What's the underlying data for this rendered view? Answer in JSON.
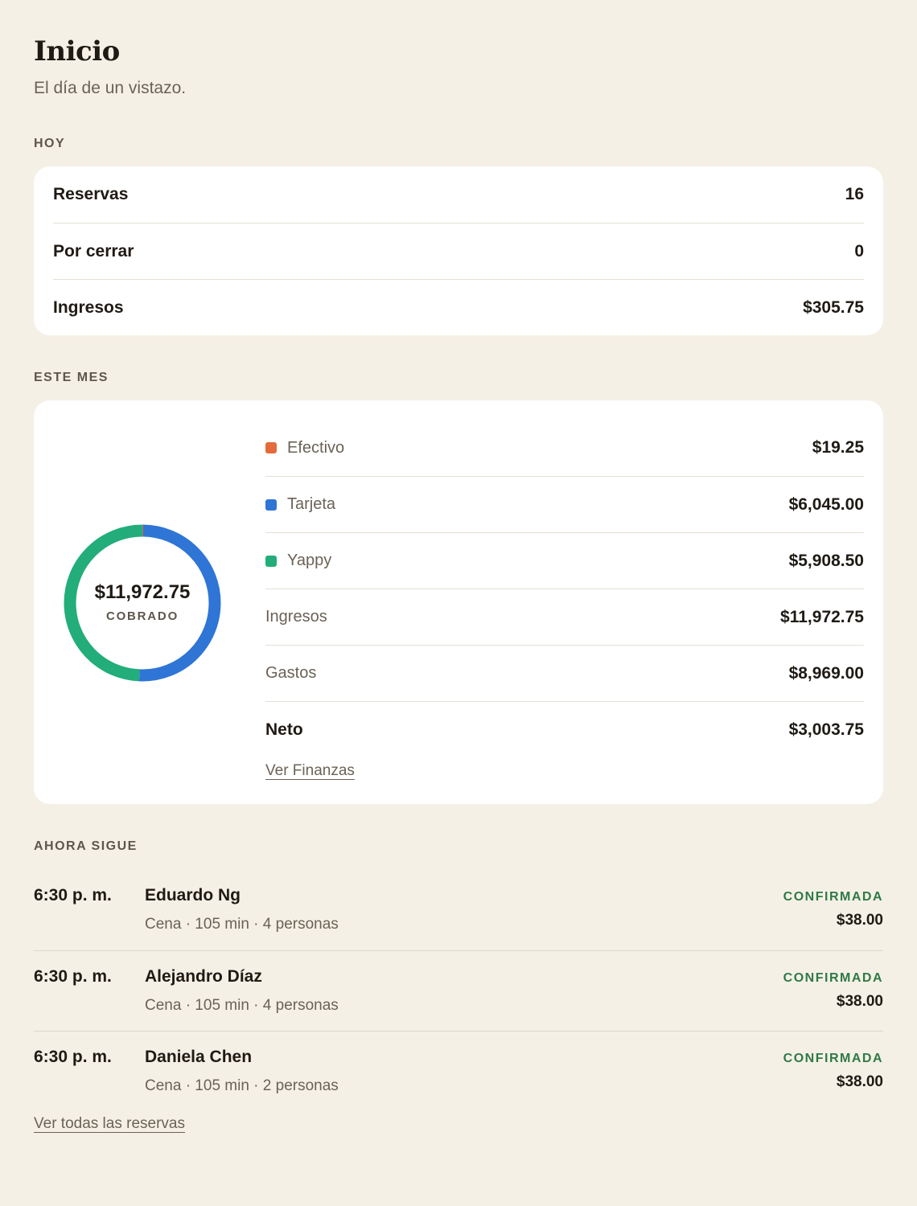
{
  "header": {
    "title": "Inicio",
    "subtitle": "El día de un vistazo."
  },
  "today": {
    "section_label": "HOY",
    "rows": [
      {
        "label": "Reservas",
        "value": "16"
      },
      {
        "label": "Por cerrar",
        "value": "0"
      },
      {
        "label": "Ingresos",
        "value": "$305.75"
      }
    ]
  },
  "month": {
    "section_label": "ESTE MES",
    "donut_total": "$11,972.75",
    "donut_caption": "COBRADO",
    "methods": [
      {
        "label": "Efectivo",
        "value": "$19.25",
        "color": "#e46a3c"
      },
      {
        "label": "Tarjeta",
        "value": "$6,045.00",
        "color": "#2f75d6"
      },
      {
        "label": "Yappy",
        "value": "$5,908.50",
        "color": "#22ad7a"
      }
    ],
    "totals": [
      {
        "label": "Ingresos",
        "value": "$11,972.75"
      },
      {
        "label": "Gastos",
        "value": "$8,969.00"
      },
      {
        "label": "Neto",
        "value": "$3,003.75"
      }
    ],
    "link": "Ver Finanzas"
  },
  "chart_data": {
    "type": "pie",
    "categories": [
      "Efectivo",
      "Tarjeta",
      "Yappy"
    ],
    "values": [
      19.25,
      6045.0,
      5908.5
    ],
    "colors": [
      "#e46a3c",
      "#2f75d6",
      "#22ad7a"
    ],
    "title": "",
    "center_label": "$11,972.75",
    "center_caption": "COBRADO"
  },
  "upcoming": {
    "section_label": "AHORA SIGUE",
    "bookings": [
      {
        "time": "6:30 p. m.",
        "name": "Eduardo Ng",
        "meta": "Cena · 105 min · 4 personas",
        "status": "CONFIRMADA",
        "amount": "$38.00"
      },
      {
        "time": "6:30 p. m.",
        "name": "Alejandro Díaz",
        "meta": "Cena · 105 min · 4 personas",
        "status": "CONFIRMADA",
        "amount": "$38.00"
      },
      {
        "time": "6:30 p. m.",
        "name": "Daniela Chen",
        "meta": "Cena · 105 min · 2 personas",
        "status": "CONFIRMADA",
        "amount": "$38.00"
      }
    ],
    "link": "Ver todas las reservas"
  }
}
